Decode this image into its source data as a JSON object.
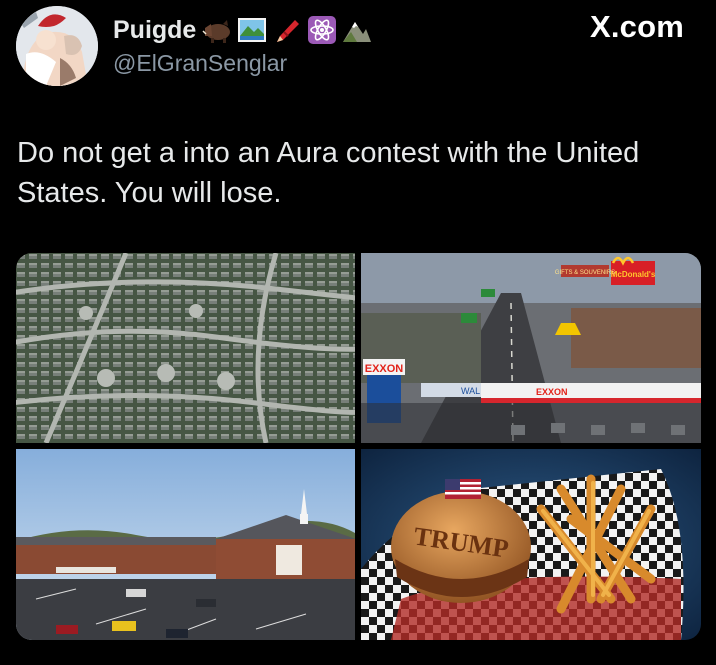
{
  "author": {
    "display_name": "Puigde",
    "handle": "@ElGranSenglar",
    "name_emojis": [
      "boar-icon",
      "national-park-icon",
      "crayon-icon",
      "atom-symbol-icon",
      "mountain-icon"
    ]
  },
  "site_label": "X.com",
  "tweet": {
    "text": "Do not get a into an Aura contest with the United States. You will lose."
  },
  "media": [
    {
      "name": "suburban-aerial-photo"
    },
    {
      "name": "highway-strip-photo",
      "signs": [
        "EXXON",
        "McDonald's",
        "GIFTS & SOUVENIRS",
        "WAL"
      ]
    },
    {
      "name": "church-parking-lot-photo"
    },
    {
      "name": "trump-burger-photo",
      "bun_text": "TRUMP"
    }
  ],
  "colors": {
    "background": "#000000",
    "text": "#e7e9ea",
    "muted": "#8b98a5"
  }
}
